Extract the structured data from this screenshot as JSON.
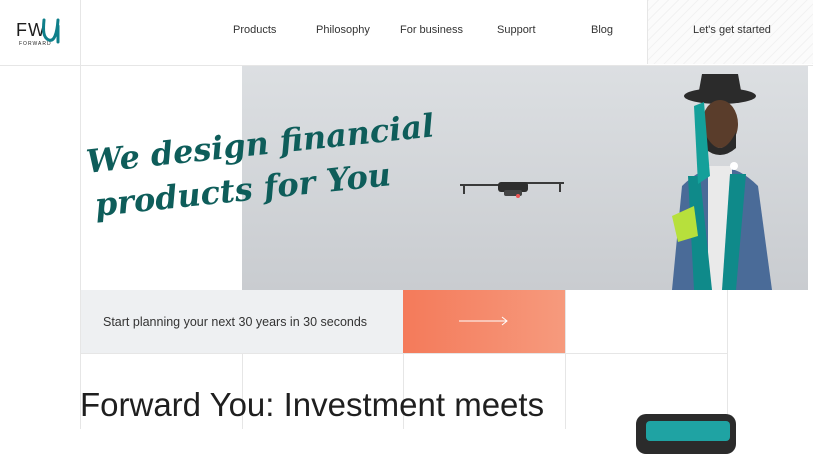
{
  "header": {
    "logo_text": "FW",
    "logo_sub": "FORWARD",
    "nav": [
      "Products",
      "Philosophy",
      "For business",
      "Support",
      "Blog"
    ],
    "cta": "Let's get started"
  },
  "hero": {
    "headline_line1": "We design financial",
    "headline_line2": "products for You"
  },
  "plan": {
    "text": "Start planning your next 30 years in 30 seconds"
  },
  "section": {
    "title": "Forward You: Investment meets"
  },
  "colors": {
    "accent_teal": "#0e5d5a",
    "accent_orange": "#f47a5a",
    "plan_bg": "#eef0f2"
  }
}
